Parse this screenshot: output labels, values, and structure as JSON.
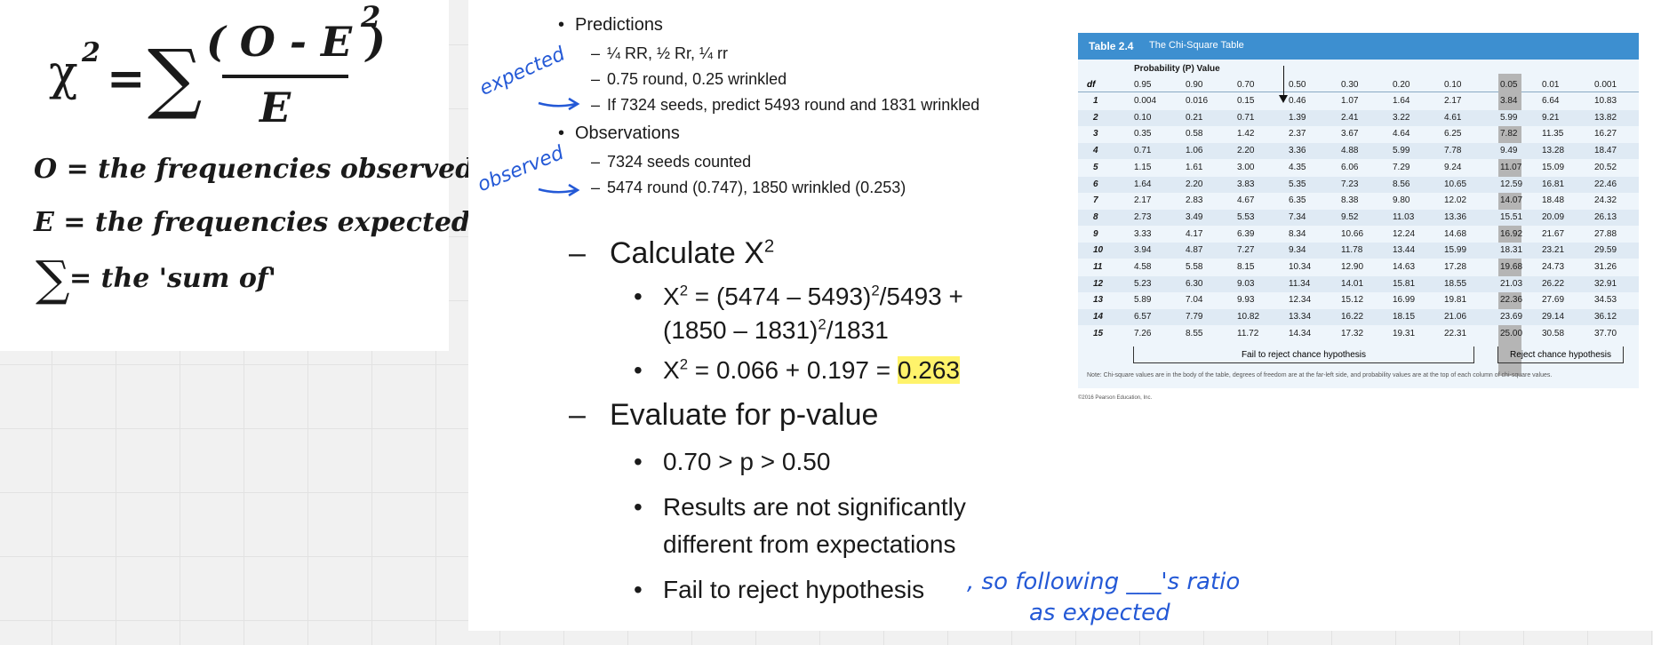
{
  "formula": {
    "chi": "χ",
    "chi_exp": "2",
    "equals": "=",
    "sigma": "∑",
    "numerator": "( O - E )",
    "numerator_exp": "2",
    "denominator": "E",
    "o_def": "O = the frequencies observed",
    "e_def": "E = the frequencies expected",
    "sum_symbol": "∑",
    "sum_def": "= the 'sum of'"
  },
  "slide": {
    "predictions_title": "Predictions",
    "pred_1": "¼ RR, ½ Rr, ¼ rr",
    "pred_2": "0.75 round, 0.25 wrinkled",
    "pred_3": "If 7324 seeds, predict 5493 round and 1831 wrinkled",
    "observations_title": "Observations",
    "obs_1": "7324 seeds counted",
    "obs_2": "5474 round (0.747), 1850 wrinkled (0.253)",
    "calc_title": "Calculate X",
    "calc_1a": "X",
    "calc_1b": " = (5474 – 5493)",
    "calc_1c": "/5493 +",
    "calc_1d": "(1850 – 1831)",
    "calc_1e": "/1831",
    "calc_2a": "X",
    "calc_2b": " = 0.066 + 0.197 = ",
    "calc_2_result": "0.263",
    "eval_title": "Evaluate for p-value",
    "eval_1": "0.70 > p > 0.50",
    "eval_2a": "Results are not significantly",
    "eval_2b": "different from expectations",
    "eval_3": "Fail to reject hypothesis",
    "sup2": "2",
    "dash": "–",
    "bullet": "•"
  },
  "handwriting": {
    "expected": "expected",
    "observed": "observed",
    "note_line1": ", so following ___'s ratio",
    "note_line2": "as expected"
  },
  "table": {
    "label": "Table 2.4",
    "title": "The Chi-Square Table",
    "prob_header": "Probability (P) Value",
    "df_header": "df",
    "p_values": [
      "0.95",
      "0.90",
      "0.70",
      "0.50",
      "0.30",
      "0.20",
      "0.10",
      "0.05",
      "0.01",
      "0.001"
    ],
    "rows": [
      [
        "1",
        "0.004",
        "0.016",
        "0.15",
        "0.46",
        "1.07",
        "1.64",
        "2.17",
        "3.84",
        "6.64",
        "10.83"
      ],
      [
        "2",
        "0.10",
        "0.21",
        "0.71",
        "1.39",
        "2.41",
        "3.22",
        "4.61",
        "5.99",
        "9.21",
        "13.82"
      ],
      [
        "3",
        "0.35",
        "0.58",
        "1.42",
        "2.37",
        "3.67",
        "4.64",
        "6.25",
        "7.82",
        "11.35",
        "16.27"
      ],
      [
        "4",
        "0.71",
        "1.06",
        "2.20",
        "3.36",
        "4.88",
        "5.99",
        "7.78",
        "9.49",
        "13.28",
        "18.47"
      ],
      [
        "5",
        "1.15",
        "1.61",
        "3.00",
        "4.35",
        "6.06",
        "7.29",
        "9.24",
        "11.07",
        "15.09",
        "20.52"
      ],
      [
        "6",
        "1.64",
        "2.20",
        "3.83",
        "5.35",
        "7.23",
        "8.56",
        "10.65",
        "12.59",
        "16.81",
        "22.46"
      ],
      [
        "7",
        "2.17",
        "2.83",
        "4.67",
        "6.35",
        "8.38",
        "9.80",
        "12.02",
        "14.07",
        "18.48",
        "24.32"
      ],
      [
        "8",
        "2.73",
        "3.49",
        "5.53",
        "7.34",
        "9.52",
        "11.03",
        "13.36",
        "15.51",
        "20.09",
        "26.13"
      ],
      [
        "9",
        "3.33",
        "4.17",
        "6.39",
        "8.34",
        "10.66",
        "12.24",
        "14.68",
        "16.92",
        "21.67",
        "27.88"
      ],
      [
        "10",
        "3.94",
        "4.87",
        "7.27",
        "9.34",
        "11.78",
        "13.44",
        "15.99",
        "18.31",
        "23.21",
        "29.59"
      ],
      [
        "11",
        "4.58",
        "5.58",
        "8.15",
        "10.34",
        "12.90",
        "14.63",
        "17.28",
        "19.68",
        "24.73",
        "31.26"
      ],
      [
        "12",
        "5.23",
        "6.30",
        "9.03",
        "11.34",
        "14.01",
        "15.81",
        "18.55",
        "21.03",
        "26.22",
        "32.91"
      ],
      [
        "13",
        "5.89",
        "7.04",
        "9.93",
        "12.34",
        "15.12",
        "16.99",
        "19.81",
        "22.36",
        "27.69",
        "34.53"
      ],
      [
        "14",
        "6.57",
        "7.79",
        "10.82",
        "13.34",
        "16.22",
        "18.15",
        "21.06",
        "23.69",
        "29.14",
        "36.12"
      ],
      [
        "15",
        "7.26",
        "8.55",
        "11.72",
        "14.34",
        "17.32",
        "19.31",
        "22.31",
        "25.00",
        "30.58",
        "37.70"
      ]
    ],
    "fail_label": "Fail to reject chance hypothesis",
    "reject_label": "Reject chance hypothesis",
    "note": "Note: Chi-square values are in the body of the table, degrees of freedom are at the far-left side, and probability values are at the top of each column of chi-square values.",
    "copyright": "©2016 Pearson Education, Inc."
  }
}
